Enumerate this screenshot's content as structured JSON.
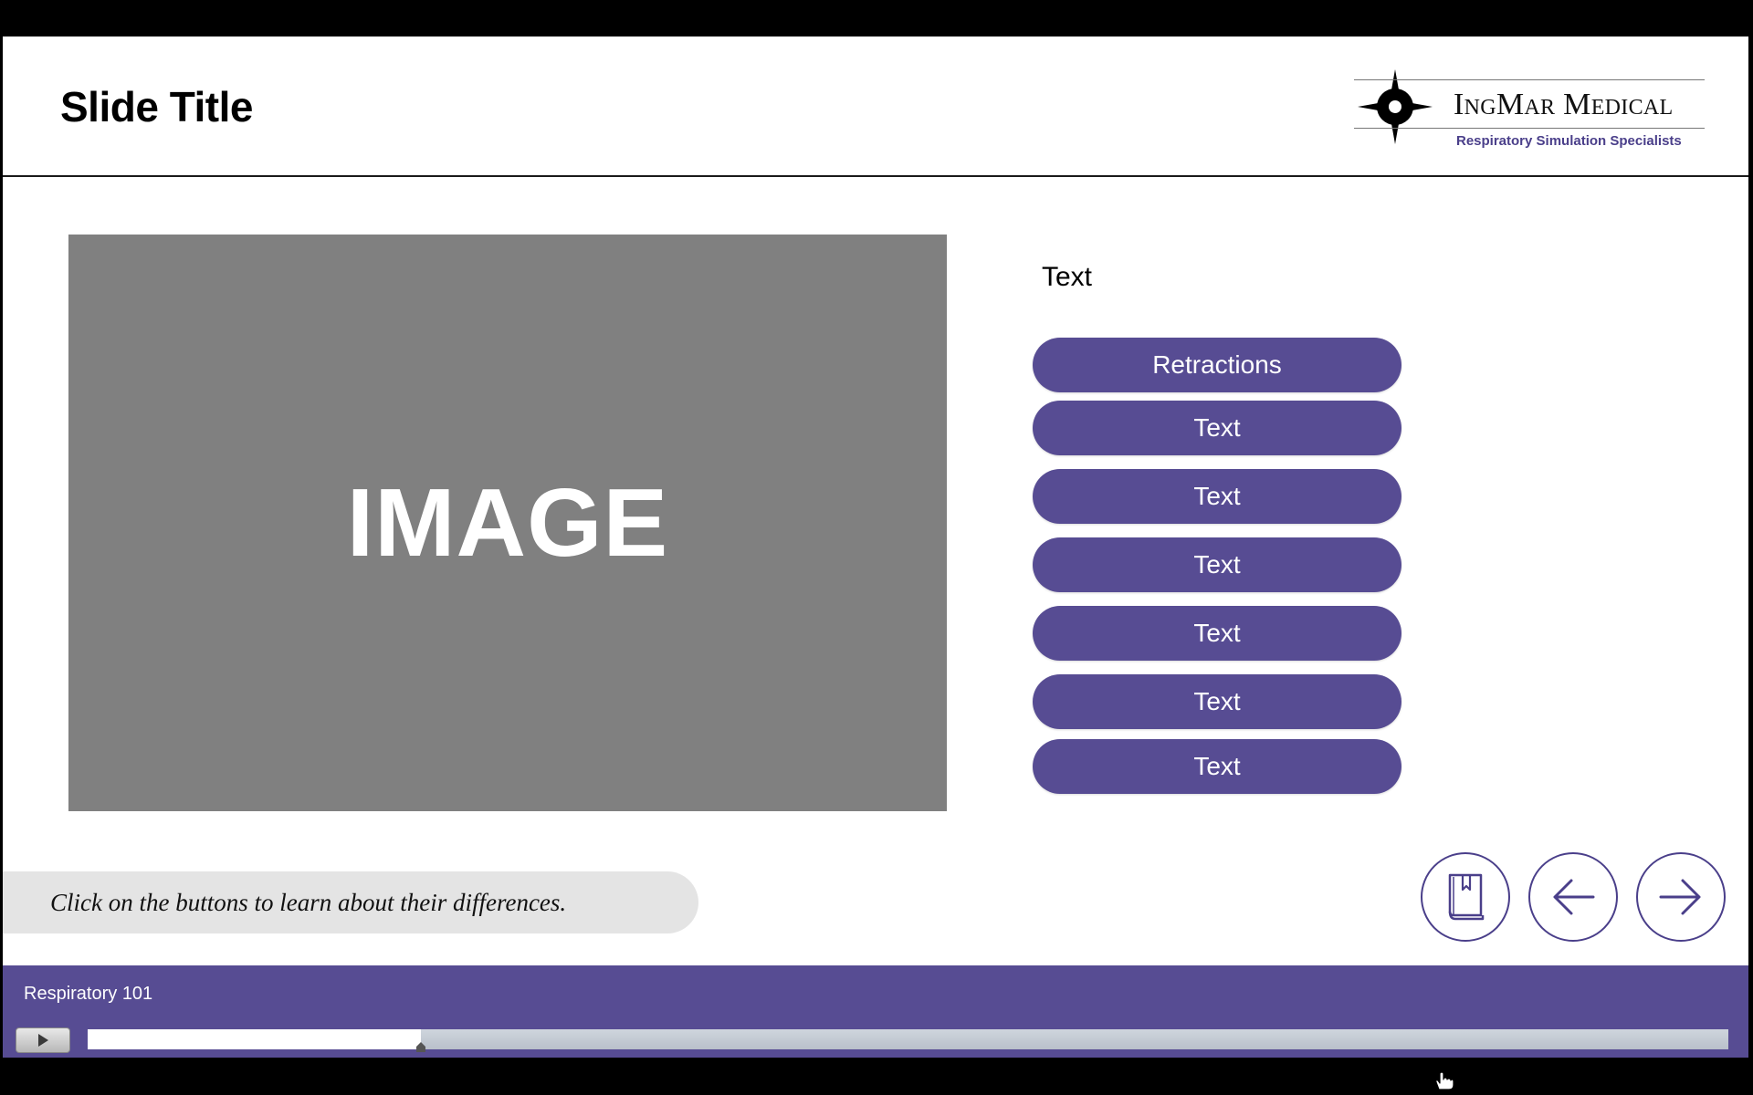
{
  "slide": {
    "title": "Slide Title",
    "image_placeholder": "IMAGE",
    "side_heading": "Text",
    "instruction": "Click on the buttons to learn about their differences."
  },
  "logo": {
    "name": "IngMar Medical",
    "tagline": "Respiratory Simulation Specialists",
    "icon": "compass-star-icon"
  },
  "buttons": [
    {
      "label": "Retractions"
    },
    {
      "label": "Text"
    },
    {
      "label": "Text"
    },
    {
      "label": "Text"
    },
    {
      "label": "Text"
    },
    {
      "label": "Text"
    },
    {
      "label": "Text"
    }
  ],
  "nav": {
    "resources_icon": "book-icon",
    "back_icon": "arrow-left-icon",
    "next_icon": "arrow-right-icon"
  },
  "player": {
    "course_title": "Respiratory 101",
    "play_icon": "play-icon",
    "progress": 0.203
  },
  "colors": {
    "accent": "#574c93",
    "accent_dark": "#4a3f8a",
    "image_placeholder": "#808080",
    "instruction_bg": "#e4e4e4"
  }
}
